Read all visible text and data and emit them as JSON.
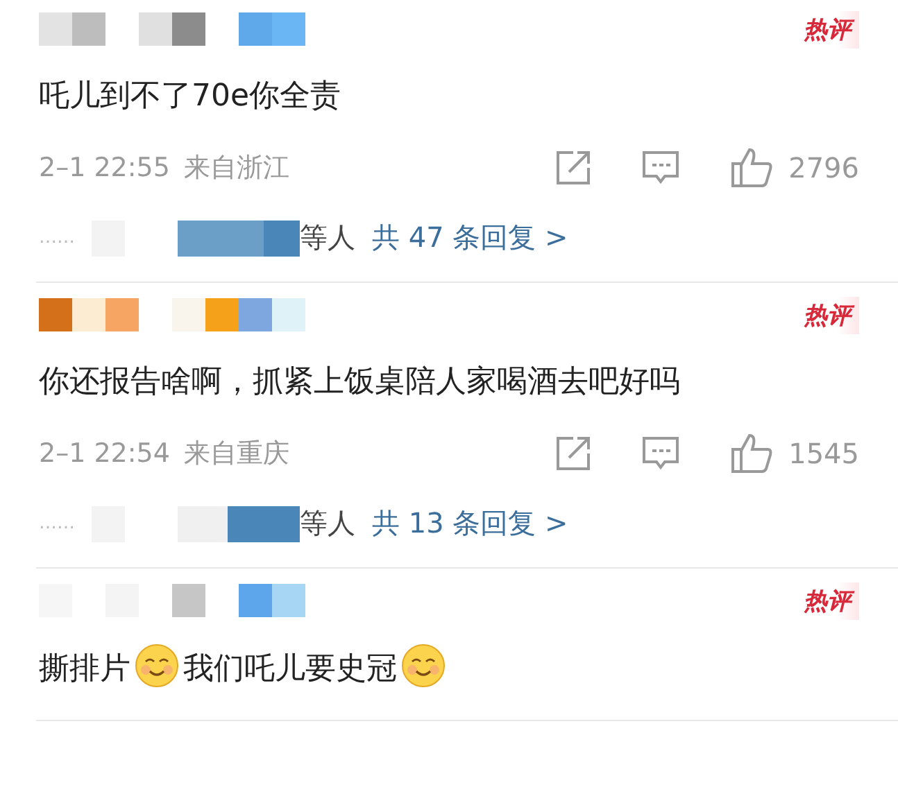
{
  "comments": [
    {
      "badge": "热评",
      "segments": [
        {
          "kind": "text",
          "text": "吒儿到不了70e你全责"
        }
      ],
      "time": "2–1 22:55",
      "location": "来自浙江",
      "likes": "2796",
      "replies": {
        "dots": "……",
        "suffix": "等人",
        "link": "共 47 条回复 >"
      }
    },
    {
      "badge": "热评",
      "segments": [
        {
          "kind": "text",
          "text": "你还报告啥啊，抓紧上饭桌陪人家喝酒去吧好吗"
        }
      ],
      "time": "2–1 22:54",
      "location": "来自重庆",
      "likes": "1545",
      "replies": {
        "dots": "……",
        "suffix": "等人",
        "link": "共 13 条回复 >"
      }
    },
    {
      "badge": "热评",
      "segments": [
        {
          "kind": "text",
          "text": "撕排片"
        },
        {
          "kind": "emoji"
        },
        {
          "kind": "text",
          "text": "我们吒儿要史冠"
        },
        {
          "kind": "emoji"
        }
      ]
    }
  ]
}
